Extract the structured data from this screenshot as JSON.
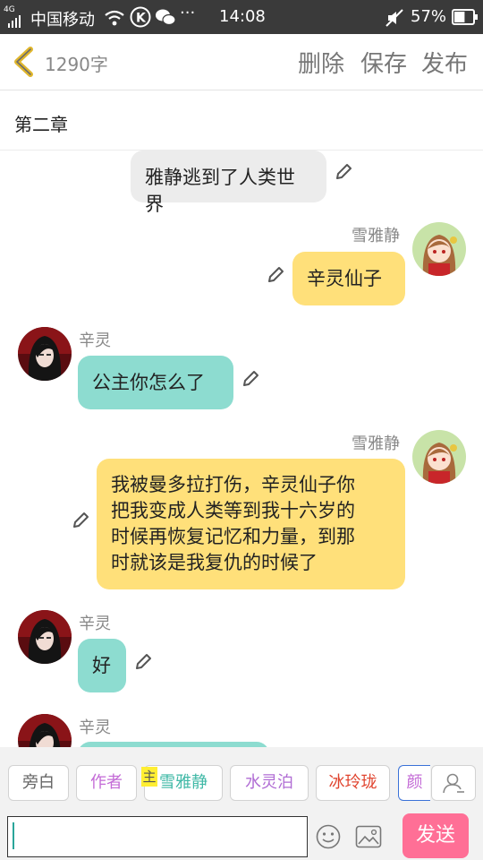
{
  "status_bar": {
    "network": "4G",
    "carrier": "中国移动",
    "time": "14:08",
    "battery_percent": "57%",
    "battery_level": 0.57,
    "more": "···",
    "icons": [
      "signal-icon",
      "wifi-icon",
      "k-app-icon",
      "wechat-icon",
      "mute-icon",
      "battery-icon"
    ]
  },
  "header": {
    "word_count": "1290字",
    "delete_label": "删除",
    "save_label": "保存",
    "publish_label": "发布"
  },
  "chapter": {
    "title": "第二章"
  },
  "messages": [
    {
      "type": "narration",
      "text": "雅静逃到了人类世界"
    },
    {
      "type": "right",
      "speaker": "雪雅静",
      "text": "辛灵仙子"
    },
    {
      "type": "left",
      "speaker": "辛灵",
      "text": "公主你怎么了"
    },
    {
      "type": "right",
      "speaker": "雪雅静",
      "lines": [
        "我被曼多拉打伤，辛灵仙子你",
        "把我变成人类等到我十六岁的",
        "时候再恢复记忆和力量，到那",
        "时就该是我复仇的时候了"
      ]
    },
    {
      "type": "left",
      "speaker": "辛灵",
      "text": "好"
    },
    {
      "type": "left",
      "speaker": "辛灵",
      "text": ""
    }
  ],
  "roles": [
    {
      "label": "旁白",
      "color": "#666666"
    },
    {
      "label": "作者",
      "color": "#c36ad6"
    },
    {
      "label": "雪雅静",
      "color": "#3fb8a6",
      "badge": "主"
    },
    {
      "label": "水灵泊",
      "color": "#b06cd4"
    },
    {
      "label": "冰玲珑",
      "color": "#e0442f"
    },
    {
      "label": "颜",
      "color": "#c36ad6"
    }
  ],
  "composer": {
    "input_value": "",
    "send_label": "发送"
  },
  "colors": {
    "narration_bubble": "#ececec",
    "user_bubble": "#ffe07a",
    "other_bubble": "#8ddcd0",
    "send_button": "#ff6f96",
    "back_arrow": "#e0b62c"
  }
}
